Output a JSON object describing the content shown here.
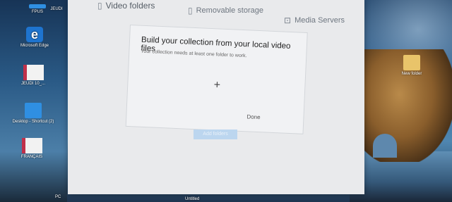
{
  "desktop": {
    "icons": [
      {
        "label": "FPUS",
        "kind": "folder"
      },
      {
        "label": "JEUDI",
        "kind": "folder"
      },
      {
        "label": "Microsoft Edge",
        "kind": "edge"
      },
      {
        "label": "JEUDI 10_...",
        "kind": "doc"
      },
      {
        "label": "Desktop - Shortcut (2)",
        "kind": "folder"
      },
      {
        "label": "FRANÇAIS",
        "kind": "doc"
      },
      {
        "label": "New folder",
        "kind": "folder"
      }
    ],
    "edge_glyph": "e"
  },
  "app": {
    "tabs": [
      {
        "label": "Video folders",
        "icon": "document-icon"
      },
      {
        "label": "Removable storage",
        "icon": "usb-icon"
      },
      {
        "label": "Media Servers",
        "icon": "media-server-icon"
      }
    ],
    "dialog": {
      "title": "Build your collection from your local video files",
      "subtitle": "Your collection needs at least one folder to work.",
      "add_glyph": "+",
      "done_label": "Done"
    },
    "add_folder_label": "Add folders"
  },
  "taskbar": {
    "items": [
      "PC",
      "Untitled"
    ]
  }
}
